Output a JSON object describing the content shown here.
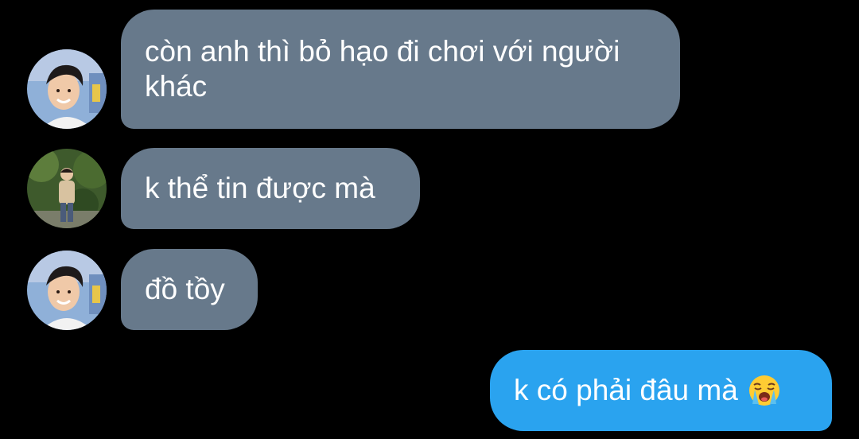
{
  "messages": [
    {
      "direction": "incoming",
      "avatar": "avatar-1",
      "text": "còn anh thì bỏ hạo đi chơi với người khác"
    },
    {
      "direction": "incoming",
      "avatar": "avatar-2",
      "text": "k thể tin được mà"
    },
    {
      "direction": "incoming",
      "avatar": "avatar-1",
      "text": "đồ tồy"
    },
    {
      "direction": "outgoing",
      "text": "k có phải đâu mà",
      "emoji": "loudly-crying-face-icon"
    }
  ],
  "colors": {
    "background": "#000000",
    "incoming_bubble": "#67798b",
    "outgoing_bubble": "#2aa3ef",
    "text": "#ffffff"
  }
}
